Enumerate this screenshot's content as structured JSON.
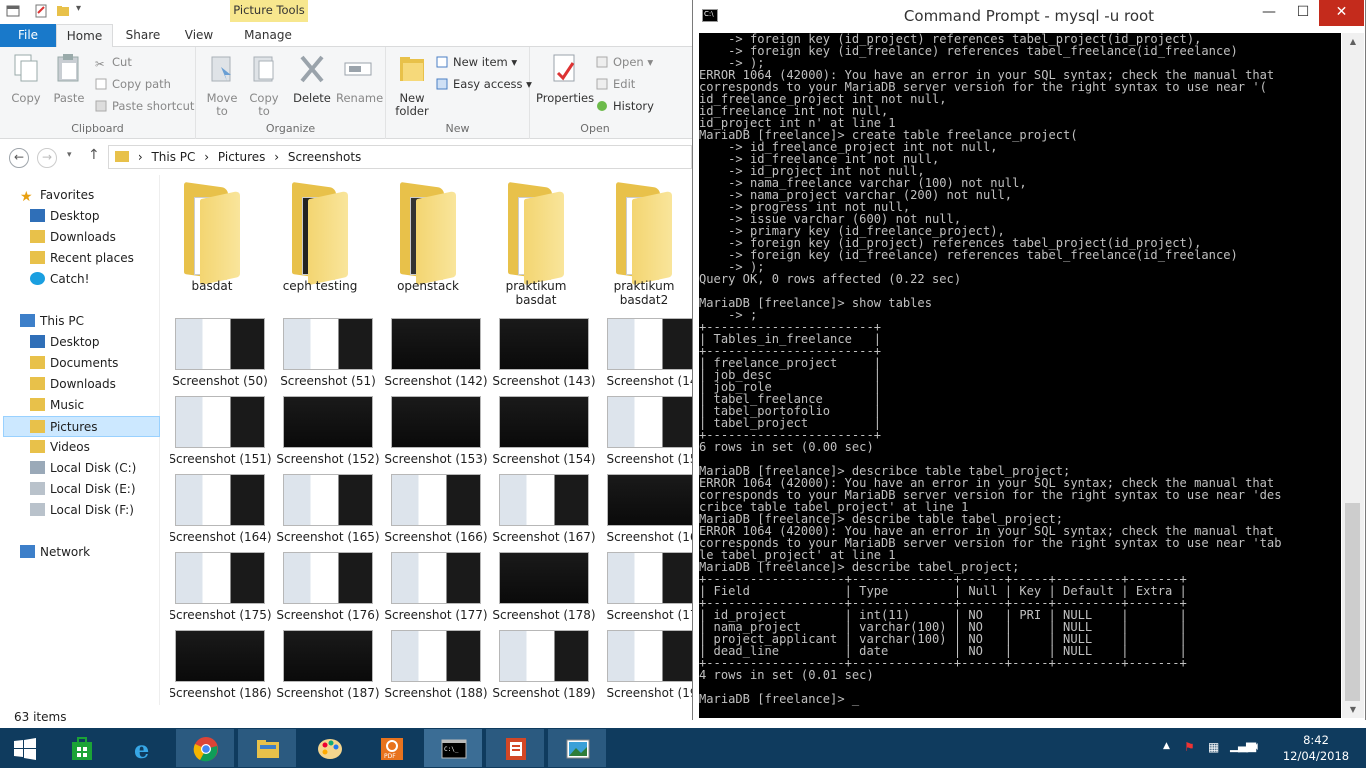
{
  "explorer": {
    "ribbon_context_tab": "Picture Tools",
    "tabs": [
      "File",
      "Home",
      "Share",
      "View",
      "Manage"
    ],
    "ribbon": {
      "clipboard": {
        "label": "Clipboard",
        "copy": "Copy",
        "paste": "Paste",
        "cut": "Cut",
        "copy_path": "Copy path",
        "paste_shortcut": "Paste shortcut"
      },
      "organize": {
        "label": "Organize",
        "move_to": "Move to",
        "copy_to": "Copy to",
        "delete": "Delete",
        "rename": "Rename"
      },
      "new": {
        "label": "New",
        "new_folder": "New folder",
        "new_item": "New item",
        "easy_access": "Easy access"
      },
      "open": {
        "label": "Open",
        "properties": "Properties",
        "open": "Open",
        "edit": "Edit",
        "history": "History"
      }
    },
    "breadcrumb": [
      "This PC",
      "Pictures",
      "Screenshots"
    ],
    "nav": {
      "favorites_header": "Favorites",
      "favorites": [
        "Desktop",
        "Downloads",
        "Recent places",
        "Catch!"
      ],
      "thispc_header": "This PC",
      "thispc": [
        "Desktop",
        "Documents",
        "Downloads",
        "Music",
        "Pictures",
        "Videos",
        "Local Disk (C:)",
        "Local Disk (E:)",
        "Local Disk (F:)"
      ],
      "network": "Network"
    },
    "folders": [
      "basdat",
      "ceph testing",
      "openstack",
      "praktikum basdat",
      "praktikum basdat2"
    ],
    "thumbnails": [
      [
        "Screenshot (50)",
        "Screenshot (51)",
        "Screenshot (142)",
        "Screenshot (143)",
        "Screenshot (14"
      ],
      [
        "Screenshot (151)",
        "Screenshot (152)",
        "Screenshot (153)",
        "Screenshot (154)",
        "Screenshot (15"
      ],
      [
        "Screenshot (164)",
        "Screenshot (165)",
        "Screenshot (166)",
        "Screenshot (167)",
        "Screenshot (16"
      ],
      [
        "Screenshot (175)",
        "Screenshot (176)",
        "Screenshot (177)",
        "Screenshot (178)",
        "Screenshot (17"
      ],
      [
        "Screenshot (186)",
        "Screenshot (187)",
        "Screenshot (188)",
        "Screenshot (189)",
        "Screenshot (19"
      ]
    ],
    "status": "63 items"
  },
  "cmd": {
    "title": "Command Prompt - mysql  -u root",
    "icon_text": "C:\\",
    "console_text": "    -> foreign key (id_project) references tabel_project(id_project),\n    -> foreign key (id_freelance) references tabel_freelance(id_freelance)\n    -> );\nERROR 1064 (42000): You have an error in your SQL syntax; check the manual that\ncorresponds to your MariaDB server version for the right syntax to use near '(\nid_freelance_project int not null,\nid_freelance int not null,\nid_project int n' at line 1\nMariaDB [freelance]> create table freelance_project(\n    -> id_freelance_project int not null,\n    -> id_freelance int not null,\n    -> id_project int not null,\n    -> nama_freelance varchar (100) not null,\n    -> nama_project varchar (200) not null,\n    -> progress int not null,\n    -> issue varchar (600) not null,\n    -> primary key (id_freelance_project),\n    -> foreign key (id_project) references tabel_project(id_project),\n    -> foreign key (id_freelance) references tabel_freelance(id_freelance)\n    -> );\nQuery OK, 0 rows affected (0.22 sec)\n\nMariaDB [freelance]> show tables\n    -> ;\n+-----------------------+\n| Tables_in_freelance   |\n+-----------------------+\n| freelance_project     |\n| job_desc              |\n| job_role              |\n| tabel_freelance       |\n| tabel_portofolio      |\n| tabel_project         |\n+-----------------------+\n6 rows in set (0.00 sec)\n\nMariaDB [freelance]> describce table tabel_project;\nERROR 1064 (42000): You have an error in your SQL syntax; check the manual that\ncorresponds to your MariaDB server version for the right syntax to use near 'des\ncribce table tabel_project' at line 1\nMariaDB [freelance]> describe table tabel_project;\nERROR 1064 (42000): You have an error in your SQL syntax; check the manual that\ncorresponds to your MariaDB server version for the right syntax to use near 'tab\nle tabel_project' at line 1\nMariaDB [freelance]> describe tabel_project;\n+-------------------+--------------+------+-----+---------+-------+\n| Field             | Type         | Null | Key | Default | Extra |\n+-------------------+--------------+------+-----+---------+-------+\n| id_project        | int(11)      | NO   | PRI | NULL    |       |\n| nama_project      | varchar(100) | NO   |     | NULL    |       |\n| project_applicant | varchar(100) | NO   |     | NULL    |       |\n| dead_line         | date         | NO   |     | NULL    |       |\n+-------------------+--------------+------+-----+---------+-------+\n4 rows in set (0.01 sec)\n\nMariaDB [freelance]> _"
  },
  "taskbar": {
    "apps": [
      "start",
      "store",
      "internet-explorer",
      "chrome",
      "file-explorer",
      "paint",
      "foxit-pdf",
      "command-prompt",
      "office-document",
      "photos"
    ],
    "time": "8:42",
    "date": "12/04/2018"
  },
  "colors": {
    "accent": "#1979ca",
    "taskbar": "#0f3b5e",
    "close": "#c42b1c",
    "picture_tools": "#f7e78e"
  }
}
